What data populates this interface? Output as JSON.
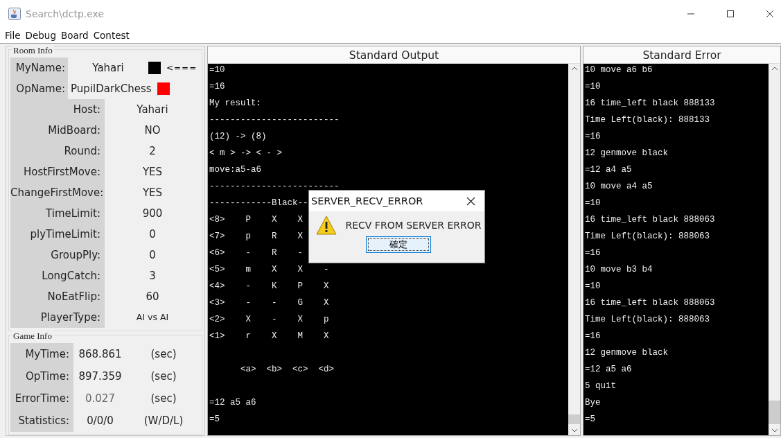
{
  "window": {
    "title": "Search\\dctp.exe"
  },
  "menu": [
    "File",
    "Debug",
    "Board",
    "Contest"
  ],
  "room_info": {
    "title": "Room Info",
    "players": [
      {
        "label": "MyName:",
        "value": "Yahari",
        "color": "#000000",
        "marker": "<==="
      },
      {
        "label": "OpName:",
        "value": "PupilDarkChess",
        "color": "#ff0000"
      }
    ],
    "fields": [
      {
        "label": "Host:",
        "value": "Yahari"
      },
      {
        "label": "MidBoard:",
        "value": "NO"
      },
      {
        "label": "Round:",
        "value": "2"
      },
      {
        "label": "HostFirstMove:",
        "value": "YES"
      },
      {
        "label": "ChangeFirstMove:",
        "value": "YES"
      },
      {
        "label": "TimeLimit:",
        "value": "900"
      },
      {
        "label": "plyTimeLimit:",
        "value": "0"
      },
      {
        "label": "GroupPly:",
        "value": "0"
      },
      {
        "label": "LongCatch:",
        "value": "3"
      },
      {
        "label": "NoEatFlip:",
        "value": "60"
      },
      {
        "label": "PlayerType:",
        "value": "AI vs AI",
        "kind": "small"
      }
    ]
  },
  "game_info": {
    "title": "Game Info",
    "rows": [
      {
        "label": "MyTime:",
        "value": "868.861",
        "unit": "(sec)",
        "disabled": false
      },
      {
        "label": "OpTime:",
        "value": "897.359",
        "unit": "(sec)",
        "disabled": false
      },
      {
        "label": "ErrorTime:",
        "value": "0.027",
        "unit": "(sec)",
        "disabled": true
      },
      {
        "label": "Statistics:",
        "value": "0/0/0",
        "unit": "(W/D/L)",
        "disabled": false
      }
    ]
  },
  "stdout": {
    "title": "Standard Output",
    "lines": [
      "=10",
      "=16",
      "My result:",
      "-------------------------",
      "(12) -> (8)",
      "< m > -> < - >",
      "move:a5-a6",
      "-------------------------",
      "------------Black--",
      "<8>    P    X    X",
      "<7>    p    R    X",
      "<6>    -    R    -",
      "<5>    m    X    X    -",
      "<4>    -    K    P    X",
      "<3>    -    -    G    X",
      "<2>    X    -    X    p",
      "<1>    r    X    M    X"
    ],
    "board_footer": "      <a>  <b>  <c>  <d>",
    "tail": [
      "=12 a5 a6",
      "=5"
    ]
  },
  "stderr": {
    "title": "Standard Error",
    "lines": [
      "10 move a6 b6",
      "=10",
      "16 time_left black 888133",
      "Time Left(black): 888133",
      "=16",
      "12 genmove black",
      "=12 a4 a5",
      "10 move a4 a5",
      "=10",
      "16 time_left black 888063",
      "Time Left(black): 888063",
      "=16",
      "10 move b3 b4",
      "=10",
      "16 time_left black 888063",
      "Time Left(black): 888063",
      "=16",
      "12 genmove black",
      "=12 a5 a6",
      "5 quit",
      "Bye",
      "=5"
    ]
  },
  "dialog": {
    "title": "SERVER_RECV_ERROR",
    "message": "RECV FROM SERVER ERROR",
    "button": "確定"
  }
}
